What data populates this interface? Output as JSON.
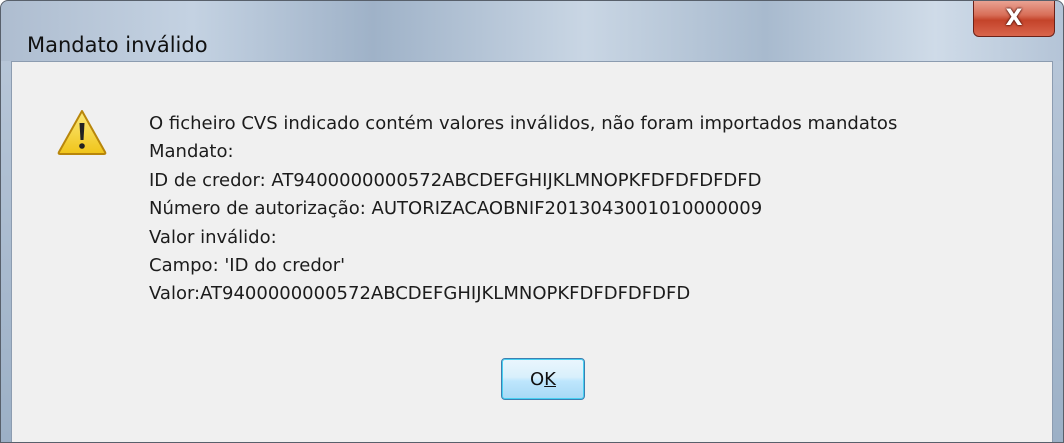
{
  "window": {
    "title": "Mandato inválido"
  },
  "close_button": {
    "glyph": "X",
    "icon": "close-icon"
  },
  "dialog": {
    "icon": "warning-icon",
    "icon_colors": {
      "triangle": "#f4d233",
      "border": "#b8860b",
      "mark": "#222222"
    },
    "message_lines": [
      "O ficheiro CVS indicado contém valores inválidos, não foram importados mandatos",
      "Mandato:",
      "ID de credor: AT9400000000572ABCDEFGHIJKLMNOPKFDFDFDFDFD",
      "Número de autorização: AUTORIZACAOBNIF2013043001010000009",
      "Valor inválido:",
      "Campo: 'ID do credor'",
      "Valor:AT9400000000572ABCDEFGHIJKLMNOPKFDFDFDFDFD"
    ]
  },
  "ok_button": {
    "label_prefix": "O",
    "label_accel": "K"
  }
}
